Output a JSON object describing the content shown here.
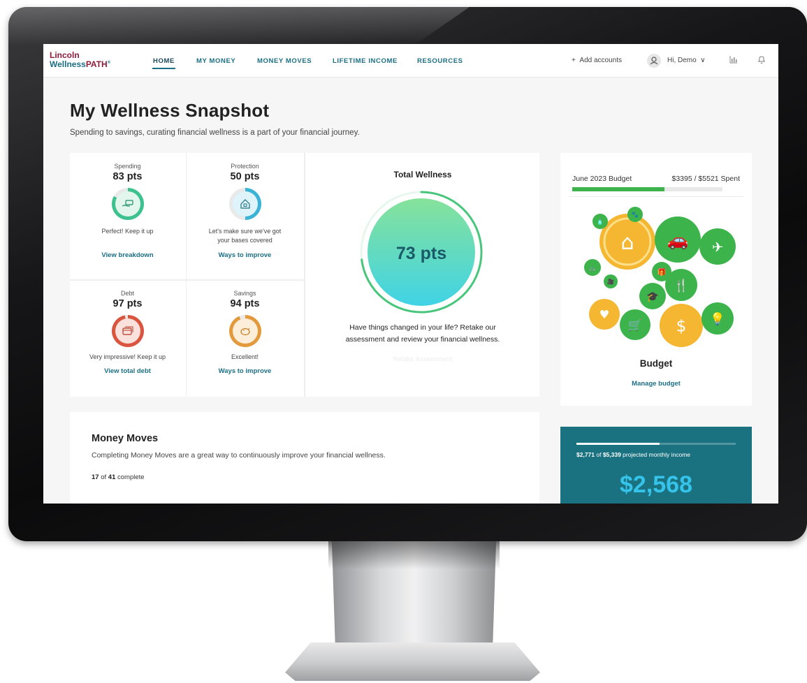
{
  "logo": {
    "line1": "Lincoln",
    "line2_a": "Wellness",
    "line2_b": "PATH",
    "reg": "®"
  },
  "nav": {
    "links": [
      {
        "label": "HOME"
      },
      {
        "label": "MY MONEY"
      },
      {
        "label": "MONEY MOVES"
      },
      {
        "label": "LIFETIME INCOME"
      },
      {
        "label": "RESOURCES"
      }
    ],
    "add_accounts": "Add accounts",
    "add_icon": "+",
    "greeting": "Hi, Demo",
    "chevron": "∨"
  },
  "page": {
    "title": "My Wellness Snapshot",
    "subtitle": "Spending to savings, curating financial wellness is a part of your financial journey."
  },
  "scores": [
    {
      "category": "Spending",
      "points": "83 pts",
      "message": "Perfect! Keep it up",
      "message2": "",
      "link": "View breakdown",
      "icon": "hand-money-icon",
      "color": "#3cc18f",
      "bg": "#e3f6ee",
      "value": 83
    },
    {
      "category": "Protection",
      "points": "50 pts",
      "message": "Let's make sure we've got",
      "message2": "your bases covered",
      "link": "Ways to improve",
      "icon": "house-lock-icon",
      "color": "#3ab3d6",
      "bg": "#dff3fa",
      "value": 50
    },
    {
      "category": "Debt",
      "points": "97 pts",
      "message": "Very impressive! Keep it up",
      "message2": "",
      "link": "View total debt",
      "icon": "credit-card-icon",
      "color": "#d9553f",
      "bg": "#fbe1db",
      "value": 97
    },
    {
      "category": "Savings",
      "points": "94 pts",
      "message": "Excellent!",
      "message2": "",
      "link": "Ways to improve",
      "icon": "piggy-bank-icon",
      "color": "#e39a3c",
      "bg": "#fdeeda",
      "value": 94
    }
  ],
  "total_wellness": {
    "title": "Total Wellness",
    "points": "73 pts",
    "value": 73,
    "message_line1": "Have things changed in your life? Retake our",
    "message_line2": "assessment and review your financial wellness.",
    "button_label": "Retake Assessment"
  },
  "budget": {
    "period": "June 2023 Budget",
    "spent": "$3395 / $5521 Spent",
    "fraction": 0.615,
    "title": "Budget",
    "link": "Manage budget",
    "bubbles": [
      {
        "name": "home-icon",
        "glyph": "⌂",
        "color": "#f5b731",
        "highlight": true
      },
      {
        "name": "car-icon",
        "glyph": "🚗",
        "color": "#3cb44b"
      },
      {
        "name": "plane-icon",
        "glyph": "✈",
        "color": "#3cb44b"
      },
      {
        "name": "dining-icon",
        "glyph": "🍴",
        "color": "#3cb44b"
      },
      {
        "name": "dollar-coin-icon",
        "glyph": "$",
        "color": "#f5b731"
      },
      {
        "name": "lightbulb-icon",
        "glyph": "💡",
        "color": "#3cb44b"
      },
      {
        "name": "health-heart-icon",
        "glyph": "♥",
        "color": "#f5b731"
      },
      {
        "name": "shopping-cart-icon",
        "glyph": "🛒",
        "color": "#3cb44b"
      },
      {
        "name": "graduation-cap-icon",
        "glyph": "🎓",
        "color": "#3cb44b"
      },
      {
        "name": "gift-icon",
        "glyph": "🎁",
        "color": "#3cb44b"
      },
      {
        "name": "bike-icon",
        "glyph": "🚲",
        "color": "#3cb44b"
      },
      {
        "name": "camera-icon",
        "glyph": "🎥",
        "color": "#3cb44b"
      },
      {
        "name": "bottles-icon",
        "glyph": "🧴",
        "color": "#3cb44b"
      },
      {
        "name": "paw-icon",
        "glyph": "🐾",
        "color": "#3cb44b"
      }
    ]
  },
  "money_moves": {
    "title": "Money Moves",
    "subtitle": "Completing Money Moves are a great way to continuously improve your financial wellness.",
    "done": "17",
    "of": " of ",
    "total": "41",
    "suffix": " complete"
  },
  "income": {
    "current": "$2,771",
    "of": " of ",
    "projected": "$5,339",
    "suffix": " projected monthly income",
    "amount": "$2,568",
    "fraction": 0.52
  }
}
